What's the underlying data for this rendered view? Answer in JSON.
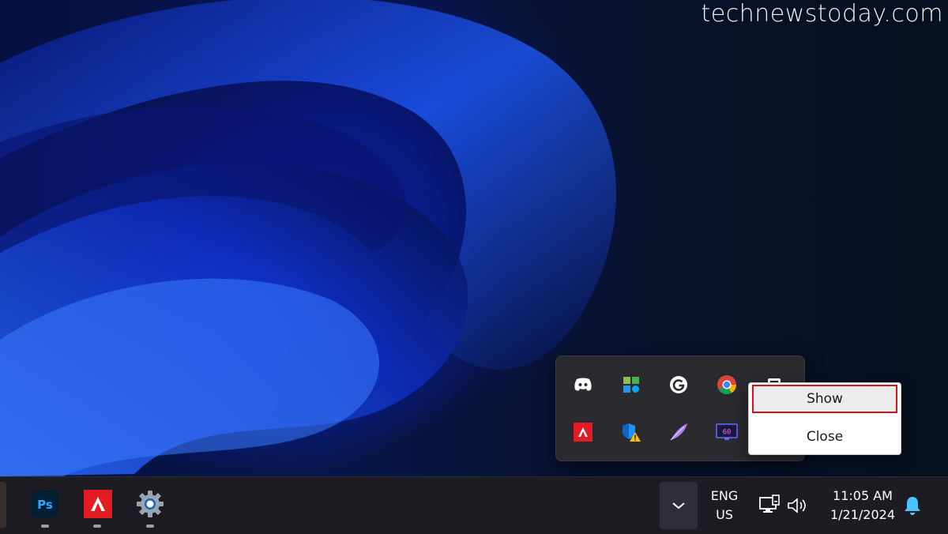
{
  "watermark": "technewstoday.com",
  "context_menu": {
    "items": [
      {
        "label": "Show",
        "highlighted": true
      },
      {
        "label": "Close",
        "highlighted": false
      }
    ],
    "highlight_color": "#d3141d"
  },
  "tray_flyout": {
    "icons": [
      "discord-icon",
      "microsoft-store-apps-icon",
      "grammarly-icon",
      "chrome-icon",
      "app-tray-icon",
      "amd-icon",
      "windows-security-warning-icon",
      "feather-icon",
      "fps-monitor-icon"
    ],
    "fps_label": "60"
  },
  "taskbar": {
    "apps": [
      {
        "name": "store-app",
        "icon": "store-icon"
      },
      {
        "name": "photoshop-app",
        "icon": "photoshop-icon",
        "label": "Ps"
      },
      {
        "name": "amd-software-app",
        "icon": "amd-icon"
      },
      {
        "name": "settings-app",
        "icon": "gear-icon"
      }
    ],
    "language": {
      "line1": "ENG",
      "line2": "US"
    },
    "clock": {
      "time": "11:05 AM",
      "date": "1/21/2024"
    }
  },
  "colors": {
    "taskbar_bg": "#1c1c22",
    "flyout_bg": "#2b2b2f",
    "accent_blue": "#4cc2ff"
  }
}
